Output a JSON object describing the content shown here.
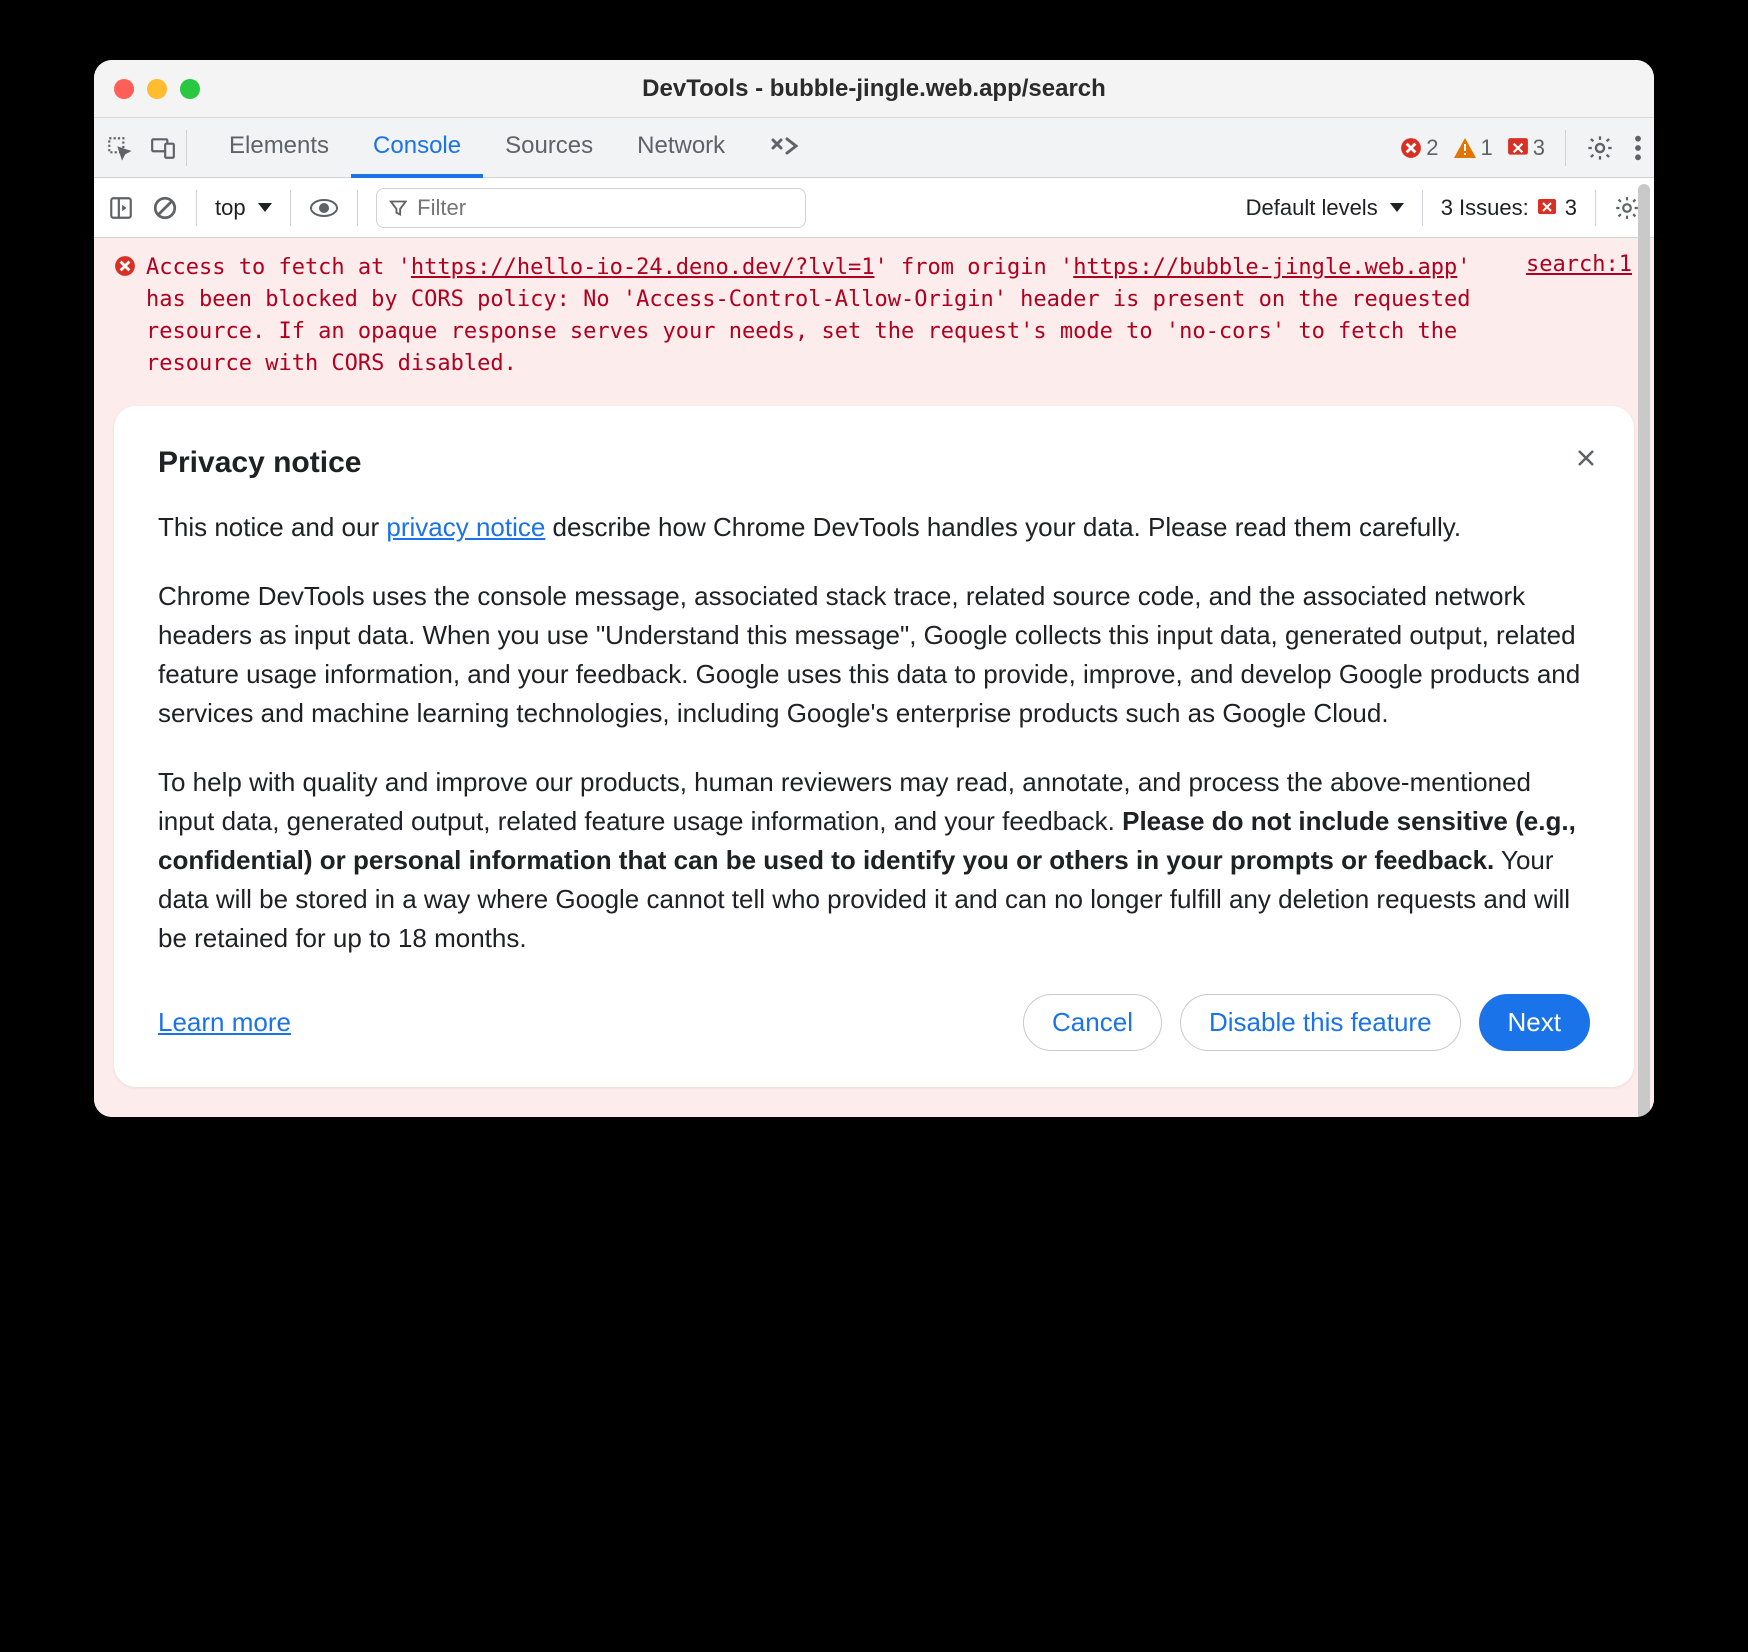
{
  "window": {
    "title": "DevTools - bubble-jingle.web.app/search"
  },
  "tabs": {
    "items": [
      "Elements",
      "Console",
      "Sources",
      "Network"
    ],
    "active": "Console"
  },
  "badges": {
    "errors": "2",
    "warnings": "1",
    "msgs": "3"
  },
  "filterbar": {
    "context": "top",
    "filter_placeholder": "Filter",
    "levels": "Default levels",
    "issues_label": "3 Issues:",
    "issues_count": "3"
  },
  "console": {
    "error_pre": "Access to fetch at '",
    "error_url1": "https://hello-io-24.deno.dev/?lvl=1",
    "error_mid1": "' from origin '",
    "error_url2": "https://bubble-jingle.web.app",
    "error_rest": "' has been blocked by CORS policy: No 'Access-Control-Allow-Origin' header is present on the requested resource. If an opaque response serves your needs, set the request's mode to 'no-cors' to fetch the resource with CORS disabled.",
    "source": "search:1"
  },
  "privacy": {
    "title": "Privacy notice",
    "intro_pre": "This notice and our ",
    "intro_link": "privacy notice",
    "intro_post": " describe how Chrome DevTools handles your data. Please read them carefully.",
    "para2": "Chrome DevTools uses the console message, associated stack trace, related source code, and the associated network headers as input data. When you use \"Understand this message\", Google collects this input data, generated output, related feature usage information, and your feedback. Google uses this data to provide, improve, and develop Google products and services and machine learning technologies, including Google's enterprise products such as Google Cloud.",
    "para3_pre": "To help with quality and improve our products, human reviewers may read, annotate, and process the above-mentioned input data, generated output, related feature usage information, and your feedback. ",
    "para3_bold": "Please do not include sensitive (e.g., confidential) or personal information that can be used to identify you or others in your prompts or feedback.",
    "para3_post": " Your data will be stored in a way where Google cannot tell who provided it and can no longer fulfill any deletion requests and will be retained for up to 18 months.",
    "learn_more": "Learn more",
    "cancel": "Cancel",
    "disable": "Disable this feature",
    "next": "Next"
  }
}
